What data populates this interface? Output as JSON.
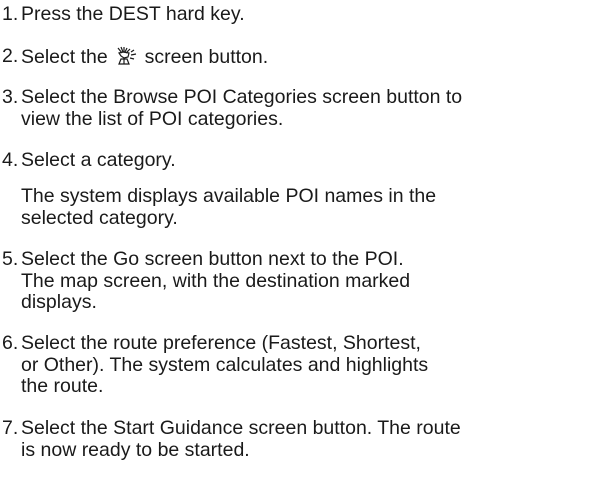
{
  "steps": [
    {
      "number": "1.",
      "lines": [
        "Press the DEST hard key."
      ]
    },
    {
      "number": "2.",
      "before_icon": "Select the",
      "icon": "statue-of-liberty-icon",
      "after_icon": "screen button."
    },
    {
      "number": "3.",
      "lines": [
        "Select the Browse POI Categories screen button to",
        "view the list of POI categories."
      ]
    },
    {
      "number": "4.",
      "lines": [
        "Select a category."
      ]
    },
    {
      "number": "5.",
      "lines": [
        "Select the Go screen button next to the POI.",
        "The map screen, with the destination marked",
        "displays."
      ]
    },
    {
      "number": "6.",
      "lines": [
        "Select the route preference (Fastest, Shortest,",
        "or Other). The system calculates and highlights",
        "the route."
      ]
    },
    {
      "number": "7.",
      "lines": [
        "Select the Start Guidance screen button. The route",
        "is now ready to be started."
      ]
    }
  ],
  "note": {
    "lines": [
      "The system displays available POI names in the",
      "selected category."
    ]
  }
}
